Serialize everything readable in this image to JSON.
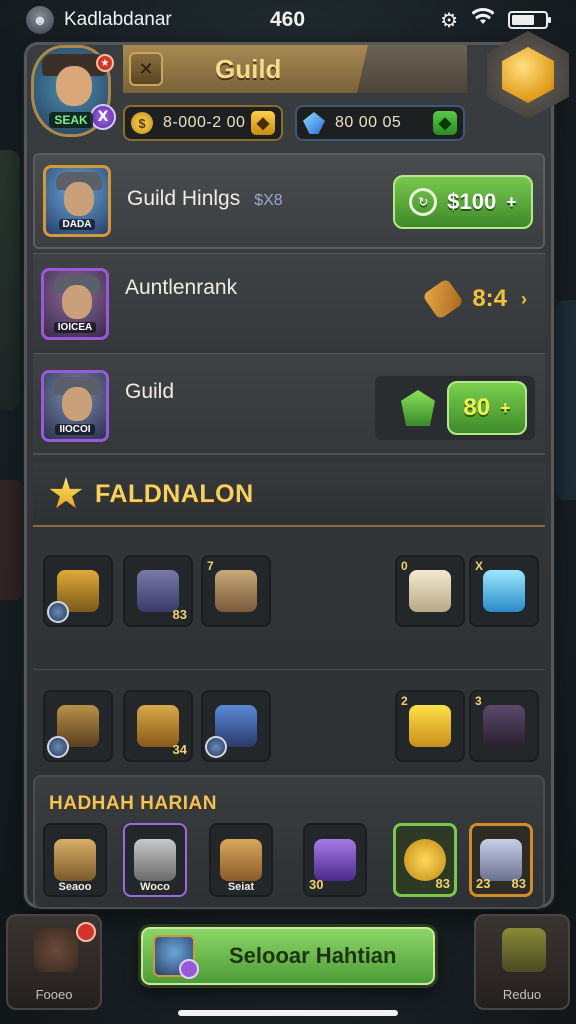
{
  "status_bar": {
    "name": "Kadlabdanar",
    "time": "460"
  },
  "header": {
    "title": "Guild",
    "hero_tag": "SEAK",
    "gold_amount": "8-000-2 00",
    "gem_amount": "80 00 05"
  },
  "rows": [
    {
      "title": "Guild Hinlgs",
      "sub": "$X8",
      "portrait_tag": "DADA",
      "price": "$100"
    },
    {
      "title": "Auntlenrank",
      "portrait_tag": "IOICEA",
      "price": "8:4"
    },
    {
      "title": "Guild",
      "portrait_tag": "IIOCOI",
      "price": "80"
    }
  ],
  "section1": {
    "title": "FALDNALON",
    "grid_top": [
      {
        "icon": "mask-icon",
        "count": "",
        "corner": ""
      },
      {
        "icon": "chest-icon",
        "count": "83",
        "corner": ""
      },
      {
        "icon": "crate-icon",
        "count": "",
        "corner": "7"
      },
      {
        "icon": "ore-icon",
        "count": "",
        "corner": "0"
      },
      {
        "icon": "crystal-icon",
        "count": "",
        "corner": "X"
      }
    ],
    "grid_bottom": [
      {
        "icon": "cannon-icon",
        "count": ""
      },
      {
        "icon": "treasure-icon",
        "count": "34"
      },
      {
        "icon": "knight-icon",
        "count": ""
      },
      {
        "icon": "gold-shard-icon",
        "count": "",
        "corner": "2"
      },
      {
        "icon": "shadow-icon",
        "count": "",
        "corner": "3"
      }
    ]
  },
  "section2": {
    "title": "HADHAH HARIAN",
    "items": [
      {
        "icon": "chest-icon",
        "label": "Seaoo"
      },
      {
        "icon": "crate-icon",
        "label": "Woco"
      },
      {
        "icon": "box-icon",
        "label": "Seiat"
      },
      {
        "icon": "shield-icon",
        "label": ""
      },
      {
        "icon": "coin-icon",
        "label": ""
      },
      {
        "icon": "cube-icon",
        "label": ""
      }
    ],
    "counts": {
      "shield": "30",
      "coin": "83",
      "cube_left": "23",
      "cube_right": "83"
    }
  },
  "bottom_nav": {
    "left_label": "Fooeo",
    "right_label": "Reduo",
    "cta_label": "Selooar Hahtian"
  },
  "colors": {
    "accent_gold": "#f6d060",
    "button_green": "#78c84e",
    "frame_purple": "#9a5ad8"
  }
}
